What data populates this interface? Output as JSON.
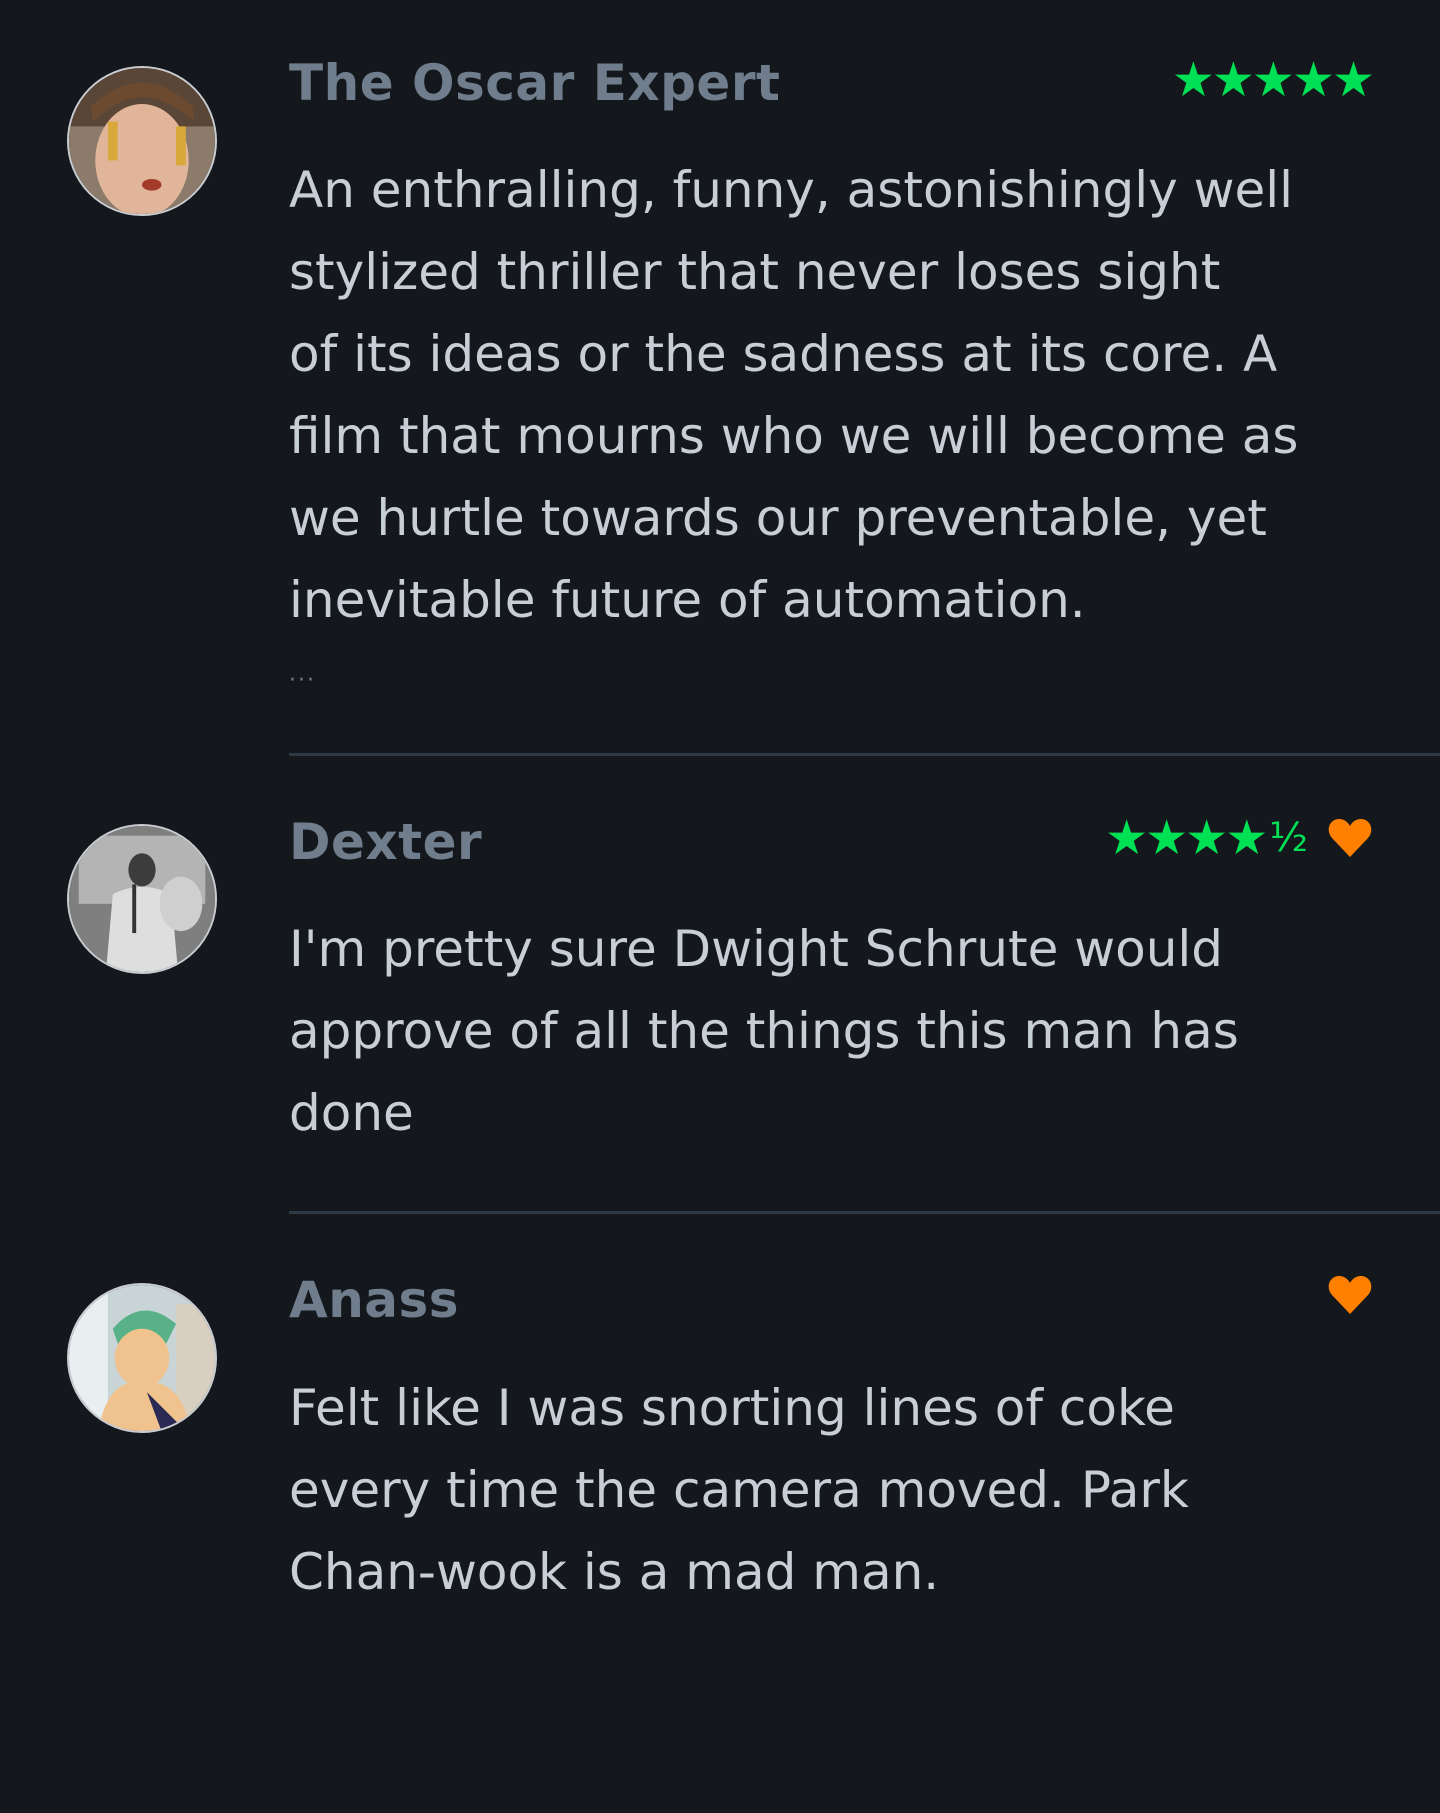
{
  "reviews": [
    {
      "author": "The Oscar Expert",
      "rating_stars": "★★★★★",
      "rating_half": "",
      "rating": 5,
      "liked": false,
      "text_lines": [
        "An enthralling, funny, astonishingly well",
        "stylized thriller that never loses sight",
        "of its ideas or the sadness at its core. A",
        "film that mourns who we will become as",
        "we hurtle towards our preventable, yet",
        "inevitable future of automation."
      ],
      "more": "···"
    },
    {
      "author": "Dexter",
      "rating_stars": "★★★★",
      "rating_half": "½",
      "rating": 4.5,
      "liked": true,
      "text_lines": [
        "I'm pretty sure Dwight Schrute would",
        "approve of all the things this man has",
        "done"
      ]
    },
    {
      "author": "Anass",
      "rating_stars": "",
      "rating_half": "",
      "liked": true,
      "text_lines": [
        "Felt like I was snorting lines of coke",
        "every time the camera moved. Park",
        "Chan-wook is a mad man."
      ]
    }
  ],
  "colors": {
    "background": "#14181d",
    "star_green": "#00e054",
    "heart_orange": "#ff8000",
    "author_gray": "#6f7d8c",
    "text": "#c7ced6",
    "divider": "#2e3944"
  },
  "icons": {
    "star": "star-icon",
    "half_star": "half-star-icon",
    "heart": "heart-icon"
  }
}
